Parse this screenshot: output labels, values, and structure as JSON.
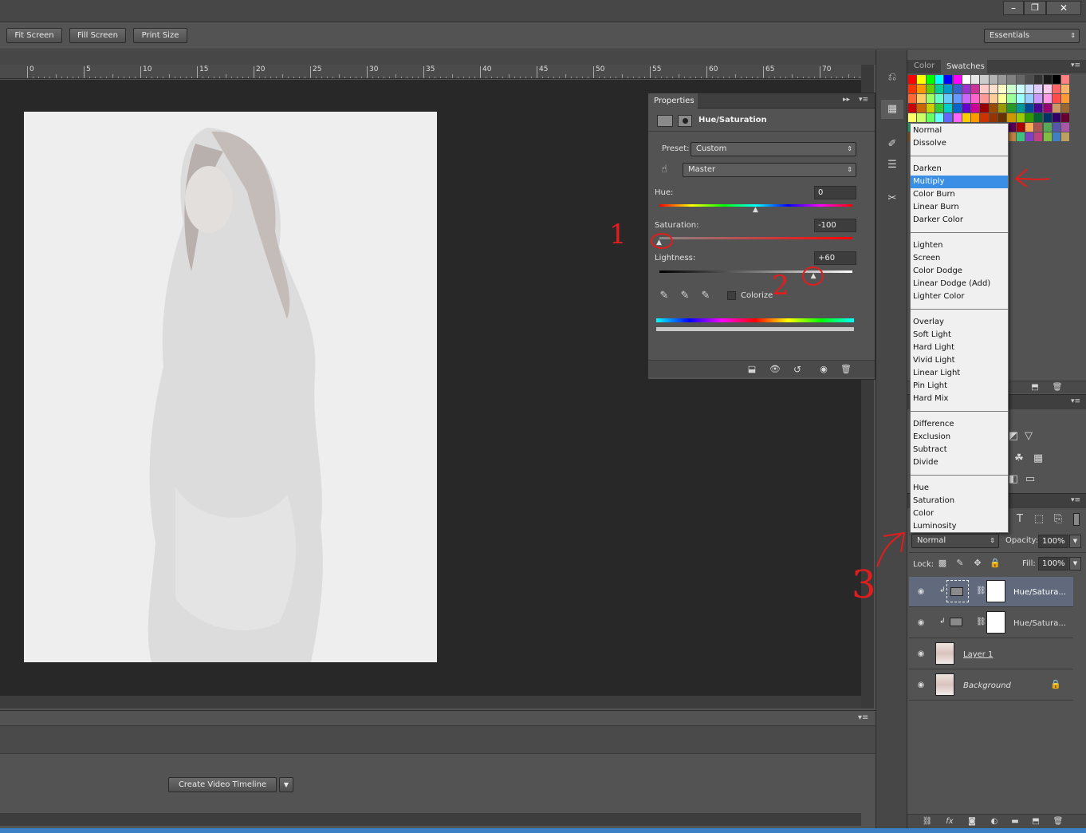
{
  "window": {
    "controls": [
      "–",
      "❐",
      "✕"
    ]
  },
  "options_bar": {
    "buttons": [
      "Fit Screen",
      "Fill Screen",
      "Print Size"
    ],
    "workspace": "Essentials"
  },
  "ruler": {
    "ticks": [
      "0",
      "5",
      "10",
      "15",
      "20",
      "25",
      "30",
      "35",
      "40",
      "45",
      "50",
      "55",
      "60",
      "65",
      "70"
    ]
  },
  "properties": {
    "tab": "Properties",
    "title": "Hue/Saturation",
    "preset_label": "Preset:",
    "preset_value": "Custom",
    "channel_value": "Master",
    "hue_label": "Hue:",
    "hue_value": "0",
    "hue_level": 0.5,
    "saturation_label": "Saturation:",
    "saturation_value": "-100",
    "saturation_level": 0.0,
    "lightness_label": "Lightness:",
    "lightness_value": "+60",
    "lightness_level": 0.8,
    "colorize_label": "Colorize"
  },
  "swatches_panel": {
    "tabs": [
      "Color",
      "Swatches"
    ]
  },
  "blend_menu": {
    "groups": [
      [
        "Normal",
        "Dissolve"
      ],
      [
        "Darken",
        "Multiply",
        "Color Burn",
        "Linear Burn",
        "Darker Color"
      ],
      [
        "Lighten",
        "Screen",
        "Color Dodge",
        "Linear Dodge (Add)",
        "Lighter Color"
      ],
      [
        "Overlay",
        "Soft Light",
        "Hard Light",
        "Vivid Light",
        "Linear Light",
        "Pin Light",
        "Hard Mix"
      ],
      [
        "Difference",
        "Exclusion",
        "Subtract",
        "Divide"
      ],
      [
        "Hue",
        "Saturation",
        "Color",
        "Luminosity"
      ]
    ],
    "selected": "Multiply"
  },
  "layers": {
    "blend_mode": "Normal",
    "opacity_label": "Opacity:",
    "opacity_value": "100%",
    "lock_label": "Lock:",
    "fill_label": "Fill:",
    "fill_value": "100%",
    "items": [
      {
        "name": "Hue/Satura..."
      },
      {
        "name": "Hue/Satura..."
      },
      {
        "name": "Layer 1"
      },
      {
        "name": "Background"
      }
    ]
  },
  "timeline": {
    "create_button": "Create Video Timeline"
  },
  "annotations": [
    "1",
    "2",
    "3"
  ],
  "colors": {
    "accent_selected": "#3a8ee6",
    "annotation": "#e11d1d"
  }
}
